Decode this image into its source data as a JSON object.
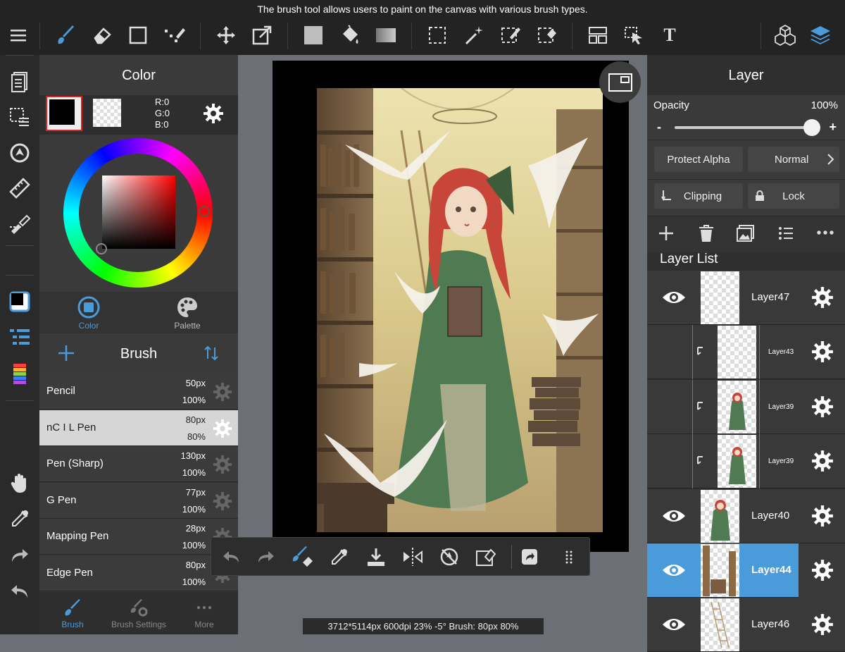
{
  "caption": "The brush tool allows users to paint on the canvas with various brush types.",
  "toolbar": {
    "left": [
      "menu-icon",
      "brush-icon",
      "eraser-icon",
      "square-icon",
      "select-pen-icon",
      "move-icon",
      "transform-icon",
      "fill-color-icon",
      "bucket-icon",
      "gradient-icon",
      "marquee-icon",
      "magic-wand-icon",
      "select-pen-icon",
      "select-eraser-icon",
      "layout-icon",
      "operation-icon",
      "text-icon"
    ],
    "right": [
      "material-icon",
      "layers-icon"
    ],
    "text_tool_glyph": "T"
  },
  "color_panel": {
    "title": "Color",
    "rgb_r": "R:0",
    "rgb_g": "G:0",
    "rgb_b": "B:0",
    "tab_color": "Color",
    "tab_palette": "Palette",
    "primary_color": "#000000"
  },
  "brush_panel": {
    "title": "Brush",
    "items": [
      {
        "name": "Pencil",
        "size": "50px",
        "opacity": "100%"
      },
      {
        "name": "nC I L Pen",
        "size": "80px",
        "opacity": "80%"
      },
      {
        "name": "Pen (Sharp)",
        "size": "130px",
        "opacity": "100%"
      },
      {
        "name": "G Pen",
        "size": "77px",
        "opacity": "100%"
      },
      {
        "name": "Mapping Pen",
        "size": "28px",
        "opacity": "100%"
      },
      {
        "name": "Edge Pen",
        "size": "80px",
        "opacity": "100%"
      }
    ],
    "tab_brush": "Brush",
    "tab_settings": "Brush Settings",
    "tab_more": "More"
  },
  "status_bar": "3712*5114px 600dpi 23% -5° Brush: 80px 80%",
  "layer_panel": {
    "title": "Layer",
    "opacity_label": "Opacity",
    "opacity_value": "100%",
    "opacity_fraction": 1.0,
    "minus": "-",
    "plus": "+",
    "protect_alpha": "Protect Alpha",
    "blend_mode": "Normal",
    "clipping": "Clipping",
    "lock": "Lock",
    "list_title": "Layer List",
    "layers": [
      {
        "name": "Layer47",
        "visible": true,
        "clipped": false,
        "selected": false
      },
      {
        "name": "Layer43",
        "visible": false,
        "clipped": true,
        "selected": false
      },
      {
        "name": "Layer39",
        "visible": false,
        "clipped": true,
        "selected": false
      },
      {
        "name": "Layer39",
        "visible": false,
        "clipped": true,
        "selected": false
      },
      {
        "name": "Layer40",
        "visible": true,
        "clipped": false,
        "selected": false
      },
      {
        "name": "Layer44",
        "visible": true,
        "clipped": false,
        "selected": true
      },
      {
        "name": "Layer46",
        "visible": true,
        "clipped": false,
        "selected": false
      }
    ]
  },
  "colors": {
    "accent": "#4a9bd9",
    "toolbar_bg": "#232323",
    "panel_bg": "#3a3a3a"
  }
}
